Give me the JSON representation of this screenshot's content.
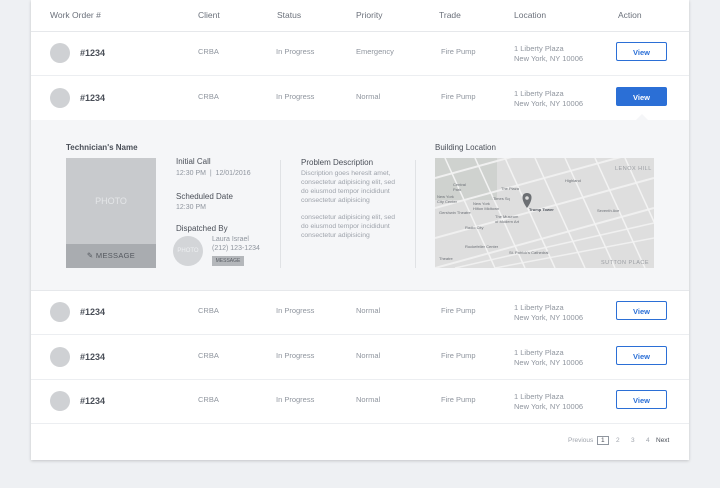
{
  "table": {
    "columns": [
      "Work Order #",
      "Client",
      "Status",
      "Priority",
      "Trade",
      "Location",
      "Action"
    ],
    "rows": [
      {
        "order": "#1234",
        "client": "CRBA",
        "status": "In Progress",
        "priority": "Emergency",
        "trade": "Fire Pump",
        "loc1": "1 Liberty Plaza",
        "loc2": "New York, NY 10006",
        "action": "View"
      },
      {
        "order": "#1234",
        "client": "CRBA",
        "status": "In Progress",
        "priority": "Normal",
        "trade": "Fire Pump",
        "loc1": "1 Liberty Plaza",
        "loc2": "New York, NY 10006",
        "action": "View"
      },
      {
        "order": "#1234",
        "client": "CRBA",
        "status": "In Progress",
        "priority": "Normal",
        "trade": "Fire Pump",
        "loc1": "1 Liberty Plaza",
        "loc2": "New York, NY 10006",
        "action": "View"
      },
      {
        "order": "#1234",
        "client": "CRBA",
        "status": "In Progress",
        "priority": "Normal",
        "trade": "Fire Pump",
        "loc1": "1 Liberty Plaza",
        "loc2": "New York, NY 10006",
        "action": "View"
      },
      {
        "order": "#1234",
        "client": "CRBA",
        "status": "In Progress",
        "priority": "Normal",
        "trade": "Fire Pump",
        "loc1": "1 Liberty Plaza",
        "loc2": "New York, NY 10006",
        "action": "View"
      }
    ]
  },
  "detail": {
    "tech_label": "Technician's Name",
    "photo_label": "PHOTO",
    "message_label": "MESSAGE",
    "initial_call_label": "Initial Call",
    "initial_call_value": "12:30 PM  |  12/01/2016",
    "scheduled_label": "Scheduled Date",
    "scheduled_value": "12:30 PM",
    "dispatched_label": "Dispatched By",
    "dispatcher_photo": "PHOTO",
    "dispatcher_name": "Laura Israel",
    "dispatcher_phone": "(212) 123-1234",
    "dispatcher_message": "MESSAGE",
    "problem_label": "Problem Description",
    "problem_text_1": "Discription goes hereslt amet, consectetur adipisicing elit, sed do eiusmod tempor incididunt consectetur adipisicing",
    "problem_text_2": "consectetur adipisicing elit, sed do eiusmod tempor incididunt consectetur adipisicing",
    "building_label": "Building Location",
    "map_labels": {
      "lenox": "LENOX HILL",
      "sutton": "SUTTON PLACE",
      "trump": "Trump Tower",
      "central": "Central",
      "park": "Park",
      "plaza": "The Plaza",
      "newyork": "New York",
      "city_center": "City Center",
      "radio": "Radio City",
      "museum": "The Museum",
      "moma": "of Modern Art",
      "newyork2": "New York",
      "hilton": "Hilton Midtown",
      "gershwin": "Gershwin Theatre",
      "seventh": "Seventh Ave",
      "rockefeller": "Rockefeller Center",
      "stpat": "St. Patrick's Cathedral",
      "times": "Times Sq",
      "theatre": "Theatre",
      "highland": "Highland"
    }
  },
  "pagination": {
    "prev": "Previous",
    "pages": [
      "1",
      "2",
      "3",
      "4"
    ],
    "next": "Next"
  },
  "colors": {
    "accent": "#2b6fd6"
  }
}
